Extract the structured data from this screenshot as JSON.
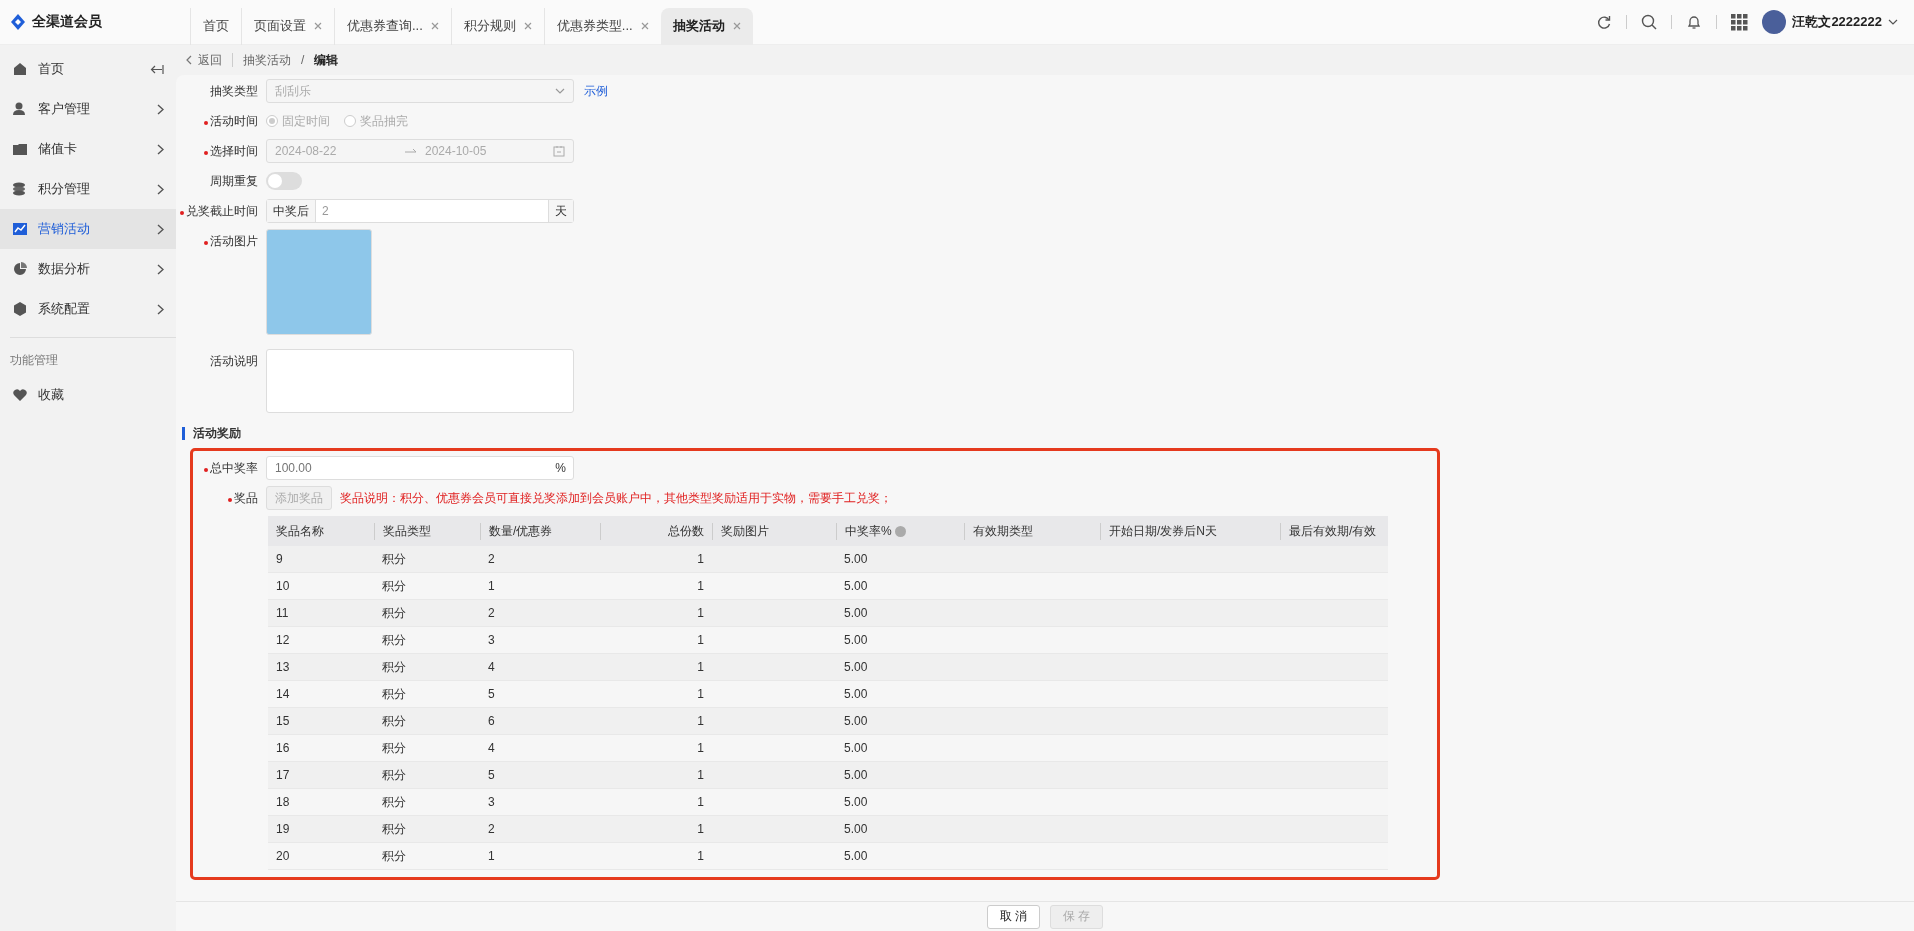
{
  "app": {
    "name": "全渠道会员"
  },
  "tabs": [
    {
      "label": "首页",
      "selected": false,
      "closable": false
    },
    {
      "label": "页面设置",
      "selected": false,
      "closable": true
    },
    {
      "label": "优惠券查询...",
      "selected": false,
      "closable": true
    },
    {
      "label": "积分规则",
      "selected": false,
      "closable": true
    },
    {
      "label": "优惠券类型...",
      "selected": false,
      "closable": true
    },
    {
      "label": "抽奖活动",
      "selected": true,
      "closable": true
    }
  ],
  "user": {
    "name": "汪乾文2222222"
  },
  "sidebar": {
    "items": [
      {
        "label": "首页",
        "selected": false,
        "expandable": false
      },
      {
        "label": "客户管理",
        "selected": false,
        "expandable": true
      },
      {
        "label": "储值卡",
        "selected": false,
        "expandable": true
      },
      {
        "label": "积分管理",
        "selected": false,
        "expandable": true
      },
      {
        "label": "营销活动",
        "selected": true,
        "expandable": true
      },
      {
        "label": "数据分析",
        "selected": false,
        "expandable": true
      },
      {
        "label": "系统配置",
        "selected": false,
        "expandable": true
      }
    ],
    "section": "功能管理",
    "extra": [
      {
        "label": "收藏",
        "selected": false,
        "expandable": false
      }
    ]
  },
  "breadcrumb": {
    "back": "返回",
    "items": [
      "抽奖活动",
      "编辑"
    ],
    "separator": "/"
  },
  "form": {
    "fields": [
      {
        "kind": "select",
        "label": "抽奖类型",
        "required": false,
        "value": "刮刮乐",
        "link": "示例"
      },
      {
        "kind": "radio",
        "label": "活动时间",
        "required": true,
        "options": [
          {
            "label": "固定时间",
            "selected": true
          },
          {
            "label": "奖品抽完",
            "selected": false
          }
        ]
      },
      {
        "kind": "daterange",
        "label": "选择时间",
        "required": true,
        "start": "2024-08-22",
        "end": "2024-10-05"
      },
      {
        "kind": "switch",
        "label": "周期重复",
        "required": false,
        "on": false
      },
      {
        "kind": "addon",
        "label": "兑奖截止时间",
        "required": true,
        "prefix": "中奖后",
        "value": "2",
        "suffix": "天"
      },
      {
        "kind": "image",
        "label": "活动图片",
        "required": true
      },
      {
        "kind": "textarea",
        "label": "活动说明",
        "required": false
      }
    ]
  },
  "reward": {
    "title": "活动奖励",
    "rate": {
      "label": "总中奖率",
      "required": true,
      "placeholder": "100.00",
      "suffix": "%"
    },
    "prize": {
      "label": "奖品",
      "required": true,
      "button": "添加奖品",
      "note": "奖品说明：积分、优惠券会员可直接兑奖添加到会员账户中，其他类型奖励适用于实物，需要手工兑奖；"
    },
    "table": {
      "columns": [
        "奖品名称",
        "奖品类型",
        "数量/优惠券",
        "总份数",
        "奖励图片",
        "中奖率%",
        "有效期类型",
        "开始日期/发券后N天",
        "最后有效期/有效"
      ],
      "rows": [
        [
          "9",
          "积分",
          "2",
          "1",
          "5.00"
        ],
        [
          "10",
          "积分",
          "1",
          "1",
          "5.00"
        ],
        [
          "11",
          "积分",
          "2",
          "1",
          "5.00"
        ],
        [
          "12",
          "积分",
          "3",
          "1",
          "5.00"
        ],
        [
          "13",
          "积分",
          "4",
          "1",
          "5.00"
        ],
        [
          "14",
          "积分",
          "5",
          "1",
          "5.00"
        ],
        [
          "15",
          "积分",
          "6",
          "1",
          "5.00"
        ],
        [
          "16",
          "积分",
          "4",
          "1",
          "5.00"
        ],
        [
          "17",
          "积分",
          "5",
          "1",
          "5.00"
        ],
        [
          "18",
          "积分",
          "3",
          "1",
          "5.00"
        ],
        [
          "19",
          "积分",
          "2",
          "1",
          "5.00"
        ],
        [
          "20",
          "积分",
          "1",
          "1",
          "5.00"
        ]
      ]
    }
  },
  "footer": {
    "buttons": [
      {
        "label": "取 消",
        "disabled": false
      },
      {
        "label": "保 存",
        "disabled": true
      }
    ]
  }
}
